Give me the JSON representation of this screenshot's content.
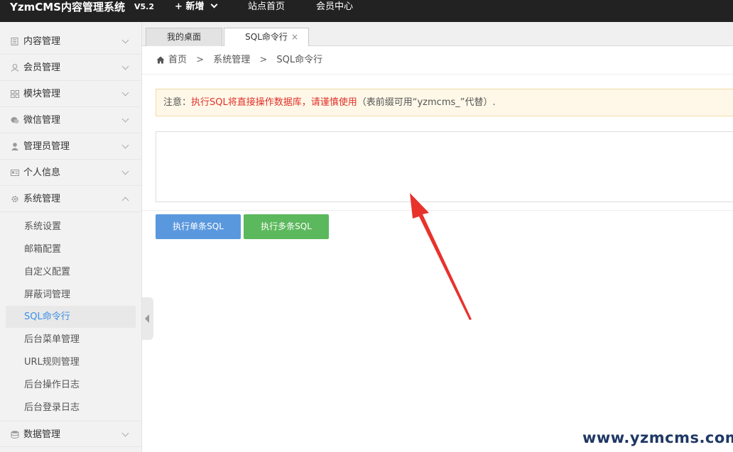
{
  "header": {
    "app_title": "YzmCMS内容管理系统",
    "version": "V5.2",
    "nav": {
      "add": "新增",
      "site_home": "站点首页",
      "member_center": "会员中心"
    }
  },
  "sidebar": {
    "items": [
      {
        "label": "内容管理",
        "icon": "document-icon"
      },
      {
        "label": "会员管理",
        "icon": "user-icon"
      },
      {
        "label": "模块管理",
        "icon": "grid-icon"
      },
      {
        "label": "微信管理",
        "icon": "wechat-icon"
      },
      {
        "label": "管理员管理",
        "icon": "person-icon"
      },
      {
        "label": "个人信息",
        "icon": "id-card-icon"
      },
      {
        "label": "系统管理",
        "icon": "gear-icon"
      },
      {
        "label": "数据管理",
        "icon": "database-icon"
      }
    ],
    "sub_items": [
      "系统设置",
      "邮箱配置",
      "自定义配置",
      "屏蔽词管理",
      "SQL命令行",
      "后台菜单管理",
      "URL规则管理",
      "后台操作日志",
      "后台登录日志"
    ],
    "active_sub": "SQL命令行"
  },
  "tabs": [
    {
      "label": "我的桌面"
    },
    {
      "label": "SQL命令行",
      "close": "×"
    }
  ],
  "breadcrumb": {
    "home": "首页",
    "sep": ">",
    "level1": "系统管理",
    "level2": "SQL命令行"
  },
  "notice": {
    "prefix": "注意：",
    "warning": "执行SQL将直接操作数据库，请谨慎使用",
    "suffix": "（表前缀可用“yzmcms_”代替）."
  },
  "sql_input": {
    "value": ""
  },
  "buttons": {
    "single": "执行单条SQL",
    "multi": "执行多条SQL"
  },
  "watermark": "www.yzmcms.com",
  "colors": {
    "topbar": "#222222",
    "active_link": "#3a8ee6",
    "btn_single": "#5a98de",
    "btn_multi": "#5cb85c",
    "warning_text": "#e0302a",
    "annotation_arrow": "#e8322c"
  }
}
